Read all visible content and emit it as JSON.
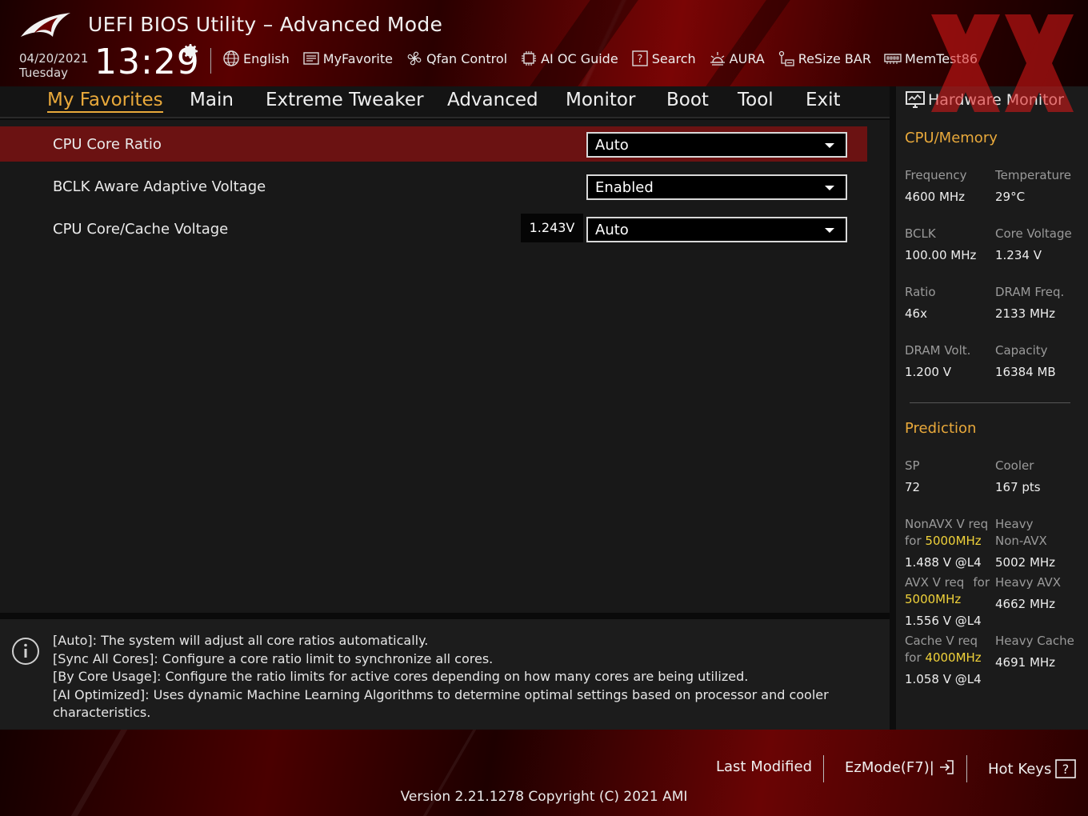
{
  "header": {
    "title": "UEFI BIOS Utility – Advanced Mode",
    "date": "04/20/2021",
    "day": "Tuesday",
    "time": "13:29",
    "tools": [
      {
        "name": "language-button",
        "icon": "globe-icon",
        "label": "English"
      },
      {
        "name": "myfavorite-button",
        "icon": "favorite-icon",
        "label": "MyFavorite"
      },
      {
        "name": "qfan-control-button",
        "icon": "fan-icon",
        "label": "Qfan Control"
      },
      {
        "name": "ai-oc-guide-button",
        "icon": "ai-chip-icon",
        "label": "AI OC Guide"
      },
      {
        "name": "search-button",
        "icon": "question-box-icon",
        "label": "Search"
      },
      {
        "name": "aura-button",
        "icon": "aura-light-icon",
        "label": "AURA"
      },
      {
        "name": "resize-bar-button",
        "icon": "resize-bar-icon",
        "label": "ReSize BAR"
      },
      {
        "name": "memtest-button",
        "icon": "memory-icon",
        "label": "MemTest86"
      }
    ]
  },
  "tabs": [
    {
      "label": "My Favorites",
      "active": true
    },
    {
      "label": "Main"
    },
    {
      "label": "Extreme Tweaker"
    },
    {
      "label": "Advanced"
    },
    {
      "label": "Monitor"
    },
    {
      "label": "Boot"
    },
    {
      "label": "Tool"
    },
    {
      "label": "Exit"
    }
  ],
  "settings": [
    {
      "label": "CPU Core Ratio",
      "value": "Auto",
      "selected": true
    },
    {
      "label": "BCLK Aware Adaptive Voltage",
      "value": "Enabled"
    },
    {
      "label": "CPU Core/Cache Voltage",
      "value": "Auto",
      "readout": "1.243V"
    }
  ],
  "help": [
    "[Auto]: The system will adjust all core ratios automatically.",
    "[Sync All Cores]: Configure a core ratio limit to synchronize all cores.",
    "[By Core Usage]: Configure the ratio limits for active cores depending on how many cores are being utilized.",
    "[AI Optimized]: Uses dynamic Machine Learning Algorithms to determine optimal settings based on processor and cooler",
    "characteristics."
  ],
  "hw_monitor": {
    "title": "Hardware Monitor",
    "cpu_memory": {
      "title": "CPU/Memory",
      "items": [
        {
          "label": "Frequency",
          "value": "4600 MHz"
        },
        {
          "label": "Temperature",
          "value": "29°C"
        },
        {
          "label": "BCLK",
          "value": "100.00 MHz"
        },
        {
          "label": "Core Voltage",
          "value": "1.234 V"
        },
        {
          "label": "Ratio",
          "value": "46x"
        },
        {
          "label": "DRAM Freq.",
          "value": "2133 MHz"
        },
        {
          "label": "DRAM Volt.",
          "value": "1.200 V"
        },
        {
          "label": "Capacity",
          "value": "16384 MB"
        }
      ]
    },
    "prediction": {
      "title": "Prediction",
      "sp_label": "SP",
      "sp_value": "72",
      "cooler_label": "Cooler",
      "cooler_value": "167 pts",
      "nonavx_label": "NonAVX V req",
      "nonavx_for": "for",
      "nonavx_freq": "5000MHz",
      "nonavx_value": "1.488 V @L4",
      "heavy_nonavx_label1": "Heavy",
      "heavy_nonavx_label2": "Non-AVX",
      "heavy_nonavx_value": "5002 MHz",
      "avx_label": "AVX V req",
      "avx_for": "for",
      "avx_freq": "5000MHz",
      "avx_value": "1.556 V @L4",
      "heavy_avx_label": "Heavy AVX",
      "heavy_avx_value": "4662 MHz",
      "cache_label": "Cache V req",
      "cache_for": "for",
      "cache_freq": "4000MHz",
      "cache_value": "1.058 V @L4",
      "heavy_cache_label": "Heavy Cache",
      "heavy_cache_value": "4691 MHz"
    }
  },
  "footer": {
    "last_modified": "Last Modified",
    "ezmode": "EzMode(F7)|",
    "hotkeys": "Hot Keys",
    "version": "Version 2.21.1278 Copyright (C) 2021 AMI"
  },
  "colors": {
    "accent": "#e9a93b",
    "selected_row": "#6b1212",
    "highlight": "#f0d23a"
  }
}
